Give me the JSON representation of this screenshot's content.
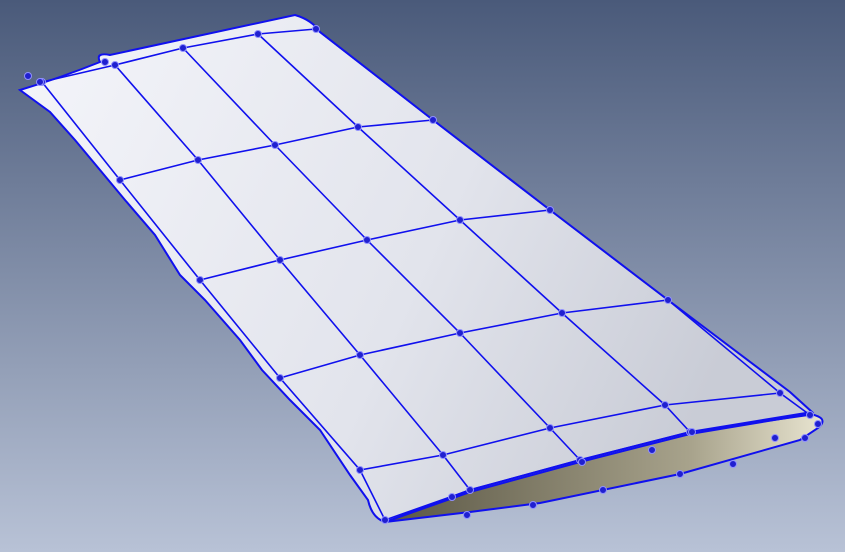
{
  "viewport": {
    "background_top": "#4a5a7a",
    "background_bottom": "#b8c2d6",
    "surface_color": "#e6e8f0",
    "underside_color": "#8a8470",
    "grid_color": "#1010ee",
    "node_color": "#2020d0"
  }
}
